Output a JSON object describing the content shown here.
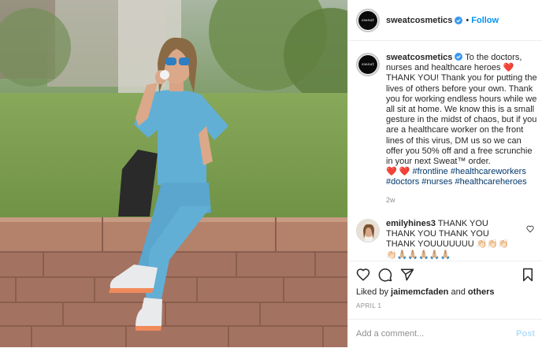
{
  "header": {
    "username": "sweatcosmetics",
    "avatar_text": "sweat",
    "separator": "•",
    "follow_label": "Follow"
  },
  "caption": {
    "username": "sweatcosmetics",
    "text_before_heart": " To the doctors, nurses and healthcare heroes ",
    "heart": "❤️",
    "text_body": " THANK YOU! Thank you for putting the lives of others before your own. Thank you for working endless hours while we all sit at home. We know this is a small gesture in the midst of chaos, but if you are a healthcare worker on the front lines of this virus, DM us so we can offer you 50% off and a free scrunchie in your next Sweat™ order.",
    "hearts": "❤️ ❤️",
    "hashtags": [
      "#frontline",
      "#healthcareworkers",
      "#doctors",
      "#nurses",
      "#healthcareheroes"
    ],
    "time_ago": "2w"
  },
  "comment": {
    "username": "emilyhines3",
    "text": " THANK YOU THANK YOU THANK YOU THANK YOUUUUUUU 👏🏻👏🏻👏🏻👏🏻🙏🏼🙏🏼🙏🏼🙏🏼🙏🏼"
  },
  "actions": {
    "liked_by_prefix": "Liked by ",
    "liked_by_user": "jaimemcfaden",
    "liked_by_and": " and ",
    "liked_by_others": "others",
    "date": "APRIL 1",
    "comment_placeholder": "Add a comment...",
    "post_label": "Post"
  },
  "colors": {
    "link_blue": "#0095f6",
    "hashtag": "#00376b",
    "muted": "#8e8e8e",
    "post_disabled": "#b2dffc"
  }
}
